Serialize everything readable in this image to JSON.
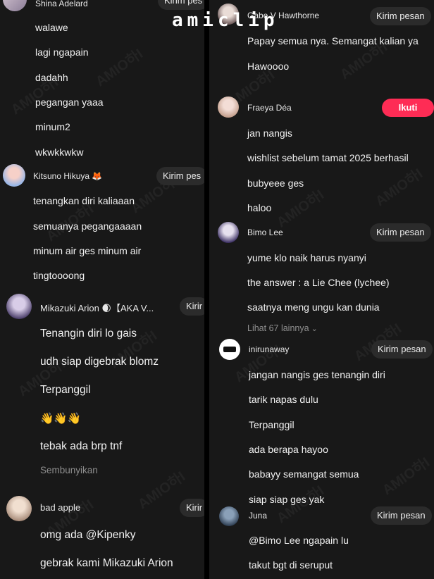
{
  "brand": "amiclip",
  "watermark": "AMIO하I",
  "colors": {
    "background": "#181818",
    "pill": "#2b2b2b",
    "follow": "#fe2c55",
    "muted": "#8e8e8e"
  },
  "left": {
    "shina": {
      "name": "Shina Adelard",
      "action": "Kirim pes",
      "messages": [
        "walawe",
        "lagi ngapain",
        "dadahh",
        "pegangan yaaa",
        "minum2",
        "wkwkkwkw"
      ]
    },
    "kitsuno": {
      "name": "Kitsuno Hikuya 🦊",
      "action": "Kirim pes",
      "messages": [
        "tenangkan diri kaliaaan",
        "semuanya pegangaaaan",
        "minum air ges minum air",
        "tingtoooong"
      ]
    },
    "mikazuki": {
      "name": "Mikazuki Arion 🌒【AKA V...",
      "action": "Kirir",
      "messages": [
        "Tenangin diri lo gais",
        "udh siap digebrak blomz",
        "Terpanggil",
        "👋👋👋",
        "tebak ada brp tnf"
      ],
      "hide_replies": "Sembunyikan"
    },
    "badapple": {
      "name": "bad apple",
      "action": "Kirir",
      "messages": [
        "omg ada @Kipenky",
        "gebrak kami Mikazuki Arion"
      ]
    }
  },
  "right": {
    "gabe": {
      "name": "Gabe V Hawthorne",
      "action": "Kirim pesan",
      "messages": [
        "Papay semua nya. Semangat kalian ya",
        "Hawoooo"
      ]
    },
    "fraeya": {
      "name": "Fraeya Déa",
      "action": "Ikuti",
      "messages": [
        "jan nangis",
        "wishlist sebelum tamat 2025 berhasil",
        "bubyeee ges",
        "haloo"
      ]
    },
    "bimo": {
      "name": "Bimo Lee",
      "action": "Kirim pesan",
      "messages": [
        "yume klo naik harus nyanyi",
        "the answer : a Lie Chee (lychee)",
        "saatnya meng ungu kan dunia"
      ],
      "more": "Lihat 67 lainnya"
    },
    "inirunaway": {
      "name": "inirunaway",
      "action": "Kirim pesan",
      "messages": [
        "jangan nangis ges tenangin diri",
        "tarik napas dulu",
        "Terpanggil",
        "ada berapa hayoo",
        "babayy semangat semua",
        "siap siap ges yak"
      ]
    },
    "juna": {
      "name": "Juna",
      "action": "Kirim pesan",
      "messages": [
        "@Bimo Lee ngapain lu",
        "takut bgt di seruput"
      ]
    }
  }
}
